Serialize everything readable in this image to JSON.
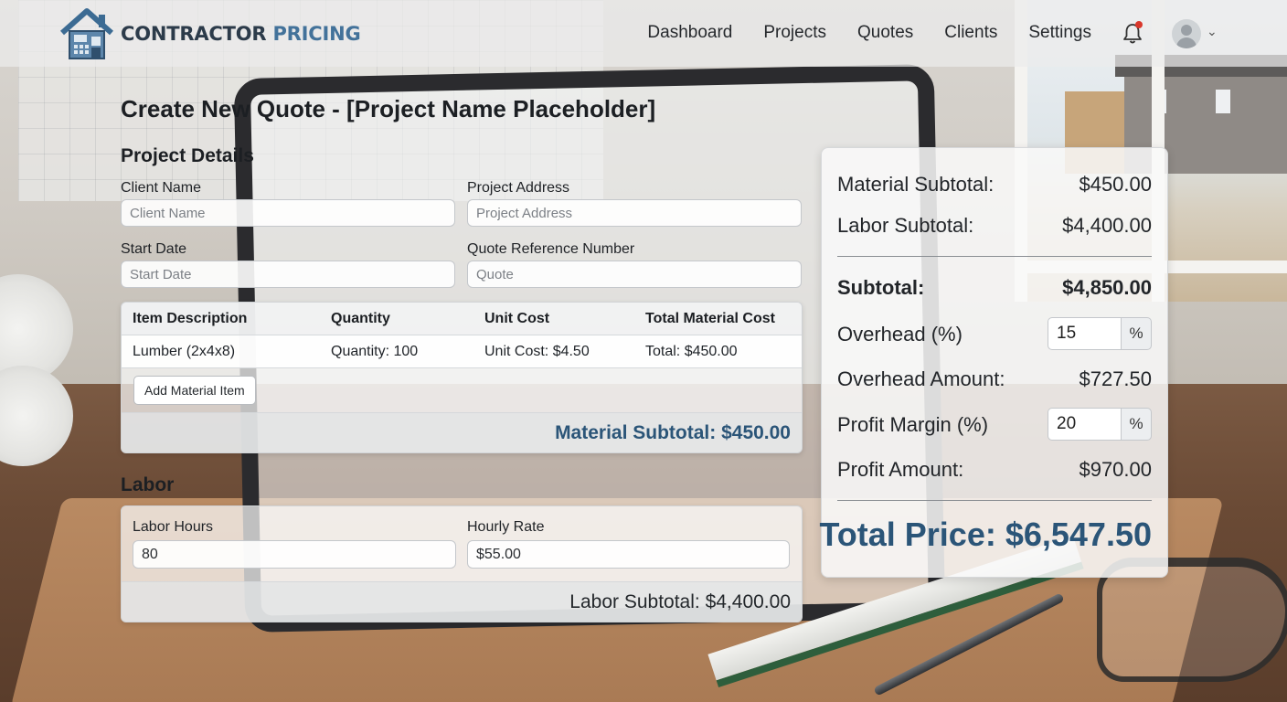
{
  "app": {
    "logo_word1": "CONTRACTOR",
    "logo_word2": "PRICING"
  },
  "nav": {
    "items": [
      "Dashboard",
      "Projects",
      "Quotes",
      "Clients",
      "Settings"
    ],
    "notification_icon": "bell-icon",
    "has_notification": true,
    "avatar_icon": "user-avatar-icon",
    "menu_icon": "chevron-down-icon"
  },
  "page": {
    "title": "Create New Quote - [Project Name Placeholder]"
  },
  "project_details": {
    "heading": "Project Details",
    "client_name": {
      "label": "Client Name",
      "placeholder": "Client Name",
      "value": ""
    },
    "project_address": {
      "label": "Project Address",
      "placeholder": "Project Address",
      "value": ""
    },
    "start_date": {
      "label": "Start Date",
      "placeholder": "Start Date",
      "value": ""
    },
    "quote_ref": {
      "label": "Quote Reference Number",
      "placeholder": "Quote",
      "value": ""
    }
  },
  "materials": {
    "columns": [
      "Item Description",
      "Quantity",
      "Unit Cost",
      "Total Material Cost"
    ],
    "rows": [
      [
        "Lumber (2x4x8)",
        "Quantity: 100",
        "Unit Cost: $4.50",
        "Total: $450.00"
      ]
    ],
    "add_button": "Add Material Item",
    "subtotal": "Material Subtotal: $450.00"
  },
  "labor": {
    "heading": "Labor",
    "hours": {
      "label": "Labor Hours",
      "value": "80"
    },
    "rate": {
      "label": "Hourly Rate",
      "value": "$55.00"
    },
    "subtotal": "Labor Subtotal: $4,400.00"
  },
  "summary": {
    "material_subtotal": {
      "label": "Material Subtotal:",
      "value": "$450.00"
    },
    "labor_subtotal": {
      "label": "Labor Subtotal:",
      "value": "$4,400.00"
    },
    "subtotal": {
      "label": "Subtotal:",
      "value": "$4,850.00"
    },
    "overhead_pct": {
      "label": "Overhead (%)",
      "value": "15",
      "suffix": "%"
    },
    "overhead_amount": {
      "label": "Overhead Amount:",
      "value": "$727.50"
    },
    "profit_pct": {
      "label": "Profit Margin (%)",
      "value": "20",
      "suffix": "%"
    },
    "profit_amount": {
      "label": "Profit Amount:",
      "value": "$970.00"
    },
    "total": "Total Price: $6,547.50"
  },
  "colors": {
    "accent": "#2b5578",
    "notification_dot": "#d9372b"
  }
}
